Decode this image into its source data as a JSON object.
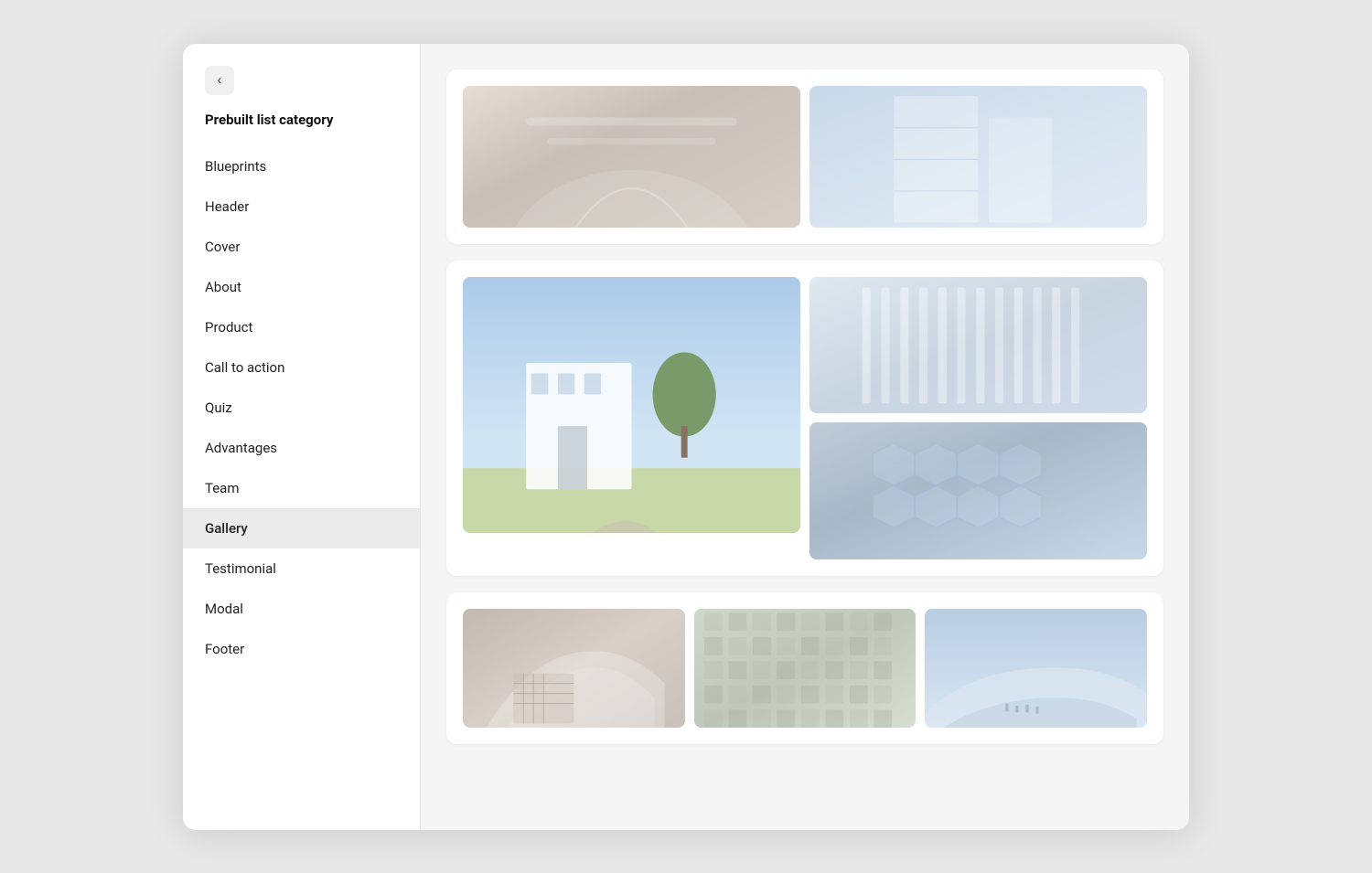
{
  "window": {
    "title": "Prebuilt list category"
  },
  "sidebar": {
    "back_label": "<",
    "section_title": "Prebuilt list category",
    "items": [
      {
        "id": "blueprints",
        "label": "Blueprints",
        "active": false
      },
      {
        "id": "header",
        "label": "Header",
        "active": false
      },
      {
        "id": "cover",
        "label": "Cover",
        "active": false
      },
      {
        "id": "about",
        "label": "About",
        "active": false
      },
      {
        "id": "product",
        "label": "Product",
        "active": false
      },
      {
        "id": "call-to-action",
        "label": "Call to action",
        "active": false
      },
      {
        "id": "quiz",
        "label": "Quiz",
        "active": false
      },
      {
        "id": "advantages",
        "label": "Advantages",
        "active": false
      },
      {
        "id": "team",
        "label": "Team",
        "active": false
      },
      {
        "id": "gallery",
        "label": "Gallery",
        "active": true
      },
      {
        "id": "testimonial",
        "label": "Testimonial",
        "active": false
      },
      {
        "id": "modal",
        "label": "Modal",
        "active": false
      },
      {
        "id": "footer",
        "label": "Footer",
        "active": false
      }
    ]
  },
  "gallery": {
    "card1": {
      "images": [
        {
          "id": "img1",
          "style_class": "arch-1"
        },
        {
          "id": "img2",
          "style_class": "arch-2"
        }
      ]
    },
    "card2": {
      "left": {
        "id": "img3",
        "style_class": "arch-3"
      },
      "right_top": {
        "id": "img4",
        "style_class": "arch-4"
      },
      "right_bottom": {
        "id": "img5",
        "style_class": "arch-5"
      }
    },
    "card3": {
      "images": [
        {
          "id": "img6",
          "style_class": "arch-7"
        },
        {
          "id": "img7",
          "style_class": "arch-8"
        },
        {
          "id": "img8",
          "style_class": "arch-9"
        }
      ]
    }
  }
}
